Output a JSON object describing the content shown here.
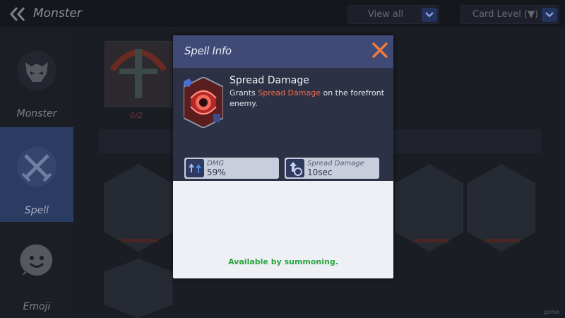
{
  "topbar": {
    "back_icon": "double-chevron-left-icon",
    "title": "Monster",
    "filter_view": "View all",
    "filter_sort": "Card Level (▼)"
  },
  "sidebar": {
    "items": [
      {
        "label": "Monster",
        "icon": "demon-mask-icon"
      },
      {
        "label": "Spell",
        "icon": "crossed-swords-icon",
        "active": true
      },
      {
        "label": "Emoji",
        "icon": "smiley-bubble-icon"
      }
    ]
  },
  "collection": {
    "count": "0/2"
  },
  "modal": {
    "title": "Spell Info",
    "close_icon": "close-x-icon",
    "spell": {
      "name": "Spread Damage",
      "desc_pre": "Grants ",
      "desc_highlight": "Spread Damage",
      "desc_post": " on the forefront enemy."
    },
    "stats": [
      {
        "label": "DMG",
        "value": "59%",
        "icon": "damage-up-icon"
      },
      {
        "label": "Spread Damage",
        "value": "10sec",
        "icon": "duration-icon"
      }
    ],
    "availability": "Available by summoning."
  },
  "watermark": "game",
  "colors": {
    "accent_header": "#3f4a76",
    "close_orange": "#f07a3a",
    "highlight": "#ee6a45",
    "available_green": "#2aa43c",
    "active_tab": "#2b3c63"
  }
}
